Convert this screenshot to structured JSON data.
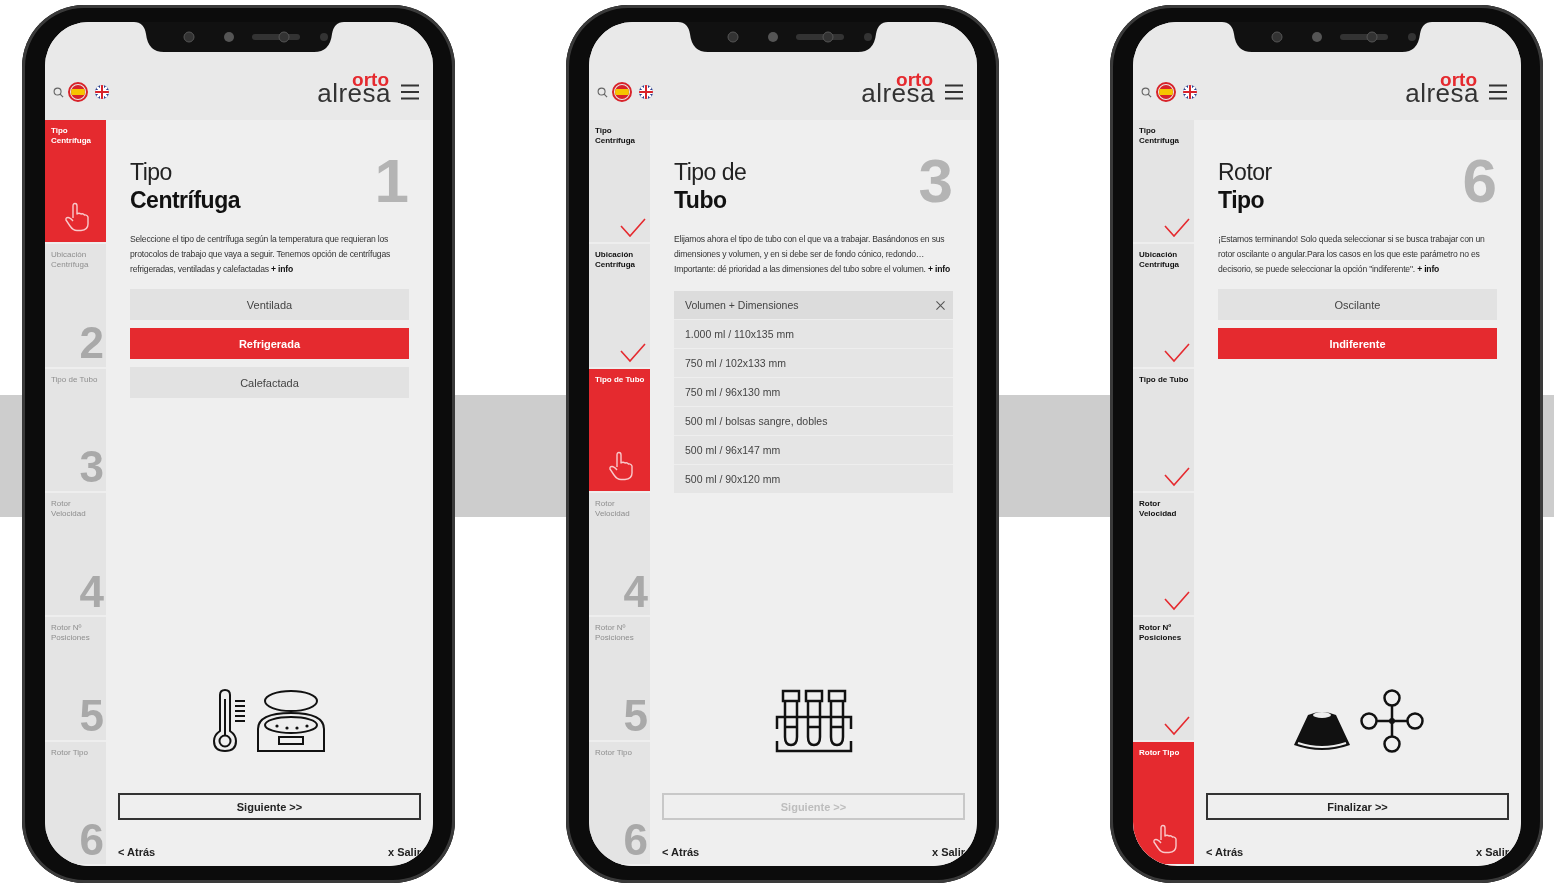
{
  "screens": [
    {
      "languages": [
        {
          "selected": true
        },
        {
          "selected": false
        }
      ],
      "logo": {
        "top": "orto",
        "bottom": "alresa"
      },
      "steps": [
        {
          "label": "Tipo Centrífuga",
          "done": false,
          "current": true
        },
        {
          "label": "Ubicación Centrífuga",
          "done": false,
          "current": false,
          "number": "2"
        },
        {
          "label": "Tipo de Tubo",
          "done": false,
          "current": false,
          "number": "3"
        },
        {
          "label": "Rotor Velocidad",
          "done": false,
          "current": false,
          "number": "4"
        },
        {
          "label": "Rotor Nº Posiciones",
          "done": false,
          "current": false,
          "number": "5"
        },
        {
          "label": "Rotor Tipo",
          "done": false,
          "current": false,
          "number": "6"
        }
      ],
      "step_number": "1",
      "title_light": "Tipo",
      "title_bold": "Centrífuga",
      "description": "Seleccione el tipo de centrífuga según la temperatura que requieran los protocolos de trabajo que vaya a seguir. Tenemos opción de centrífugas refrigeradas, ventiladas y calefactadas",
      "info_link": "+ info",
      "options": [
        {
          "label": "Ventilada",
          "selected": false
        },
        {
          "label": "Refrigerada",
          "selected": true
        },
        {
          "label": "Calefactada",
          "selected": false
        }
      ],
      "next_button": {
        "label": "Siguiente >>",
        "disabled": false
      },
      "back": "< Atrás",
      "exit": "x Salir"
    },
    {
      "languages": [
        {
          "selected": true
        },
        {
          "selected": false
        }
      ],
      "logo": {
        "top": "orto",
        "bottom": "alresa"
      },
      "steps": [
        {
          "label": "Tipo Centrífuga",
          "done": true,
          "current": false
        },
        {
          "label": "Ubicación Centrífuga",
          "done": true,
          "current": false
        },
        {
          "label": "Tipo de Tubo",
          "done": false,
          "current": true
        },
        {
          "label": "Rotor Velocidad",
          "done": false,
          "current": false,
          "number": "4"
        },
        {
          "label": "Rotor Nº Posiciones",
          "done": false,
          "current": false,
          "number": "5"
        },
        {
          "label": "Rotor Tipo",
          "done": false,
          "current": false,
          "number": "6"
        }
      ],
      "step_number": "3",
      "title_light": "Tipo de",
      "title_bold": "Tubo",
      "description": "Elijamos ahora el tipo de tubo con el que va a trabajar.   Basándonos en sus dimensiones y volumen, y en si debe ser de fondo cónico, redondo… Importante: dé prioridad a las dimensiones del tubo sobre el volumen.",
      "info_link": "+ info",
      "dropdown": {
        "header": "Volumen + Dimensiones",
        "items": [
          "1.000 ml / 110x135 mm",
          "750 ml / 102x133 mm",
          "750 ml / 96x130 mm",
          "500 ml / bolsas sangre, dobles",
          "500 ml / 96x147 mm",
          "500 ml / 90x120 mm"
        ]
      },
      "next_button": {
        "label": "Siguiente >>",
        "disabled": true
      },
      "back": "< Atrás",
      "exit": "x Salir"
    },
    {
      "languages": [
        {
          "selected": true
        },
        {
          "selected": false
        }
      ],
      "logo": {
        "top": "orto",
        "bottom": "alresa"
      },
      "steps": [
        {
          "label": "Tipo Centrífuga",
          "done": true,
          "current": false
        },
        {
          "label": "Ubicación Centrífuga",
          "done": true,
          "current": false
        },
        {
          "label": "Tipo de Tubo",
          "done": true,
          "current": false
        },
        {
          "label": "Rotor Velocidad",
          "done": true,
          "current": false
        },
        {
          "label": "Rotor Nº Posiciones",
          "done": true,
          "current": false
        },
        {
          "label": "Rotor Tipo",
          "done": false,
          "current": true
        }
      ],
      "step_number": "6",
      "title_light": "Rotor",
      "title_bold": "Tipo",
      "description": "¡Estamos terminando! Solo queda seleccionar si se busca trabajar con un rotor oscilante o angular.Para los casos en los que este parámetro no es decisorio, se puede seleccionar la opción \"indiferente\".",
      "info_link": "+ info",
      "options": [
        {
          "label": "Oscilante",
          "selected": false
        },
        {
          "label": "Indiferente",
          "selected": true
        }
      ],
      "next_button": {
        "label": "Finalizar >>",
        "disabled": false
      },
      "back": "< Atrás",
      "exit": "x Salir"
    }
  ]
}
